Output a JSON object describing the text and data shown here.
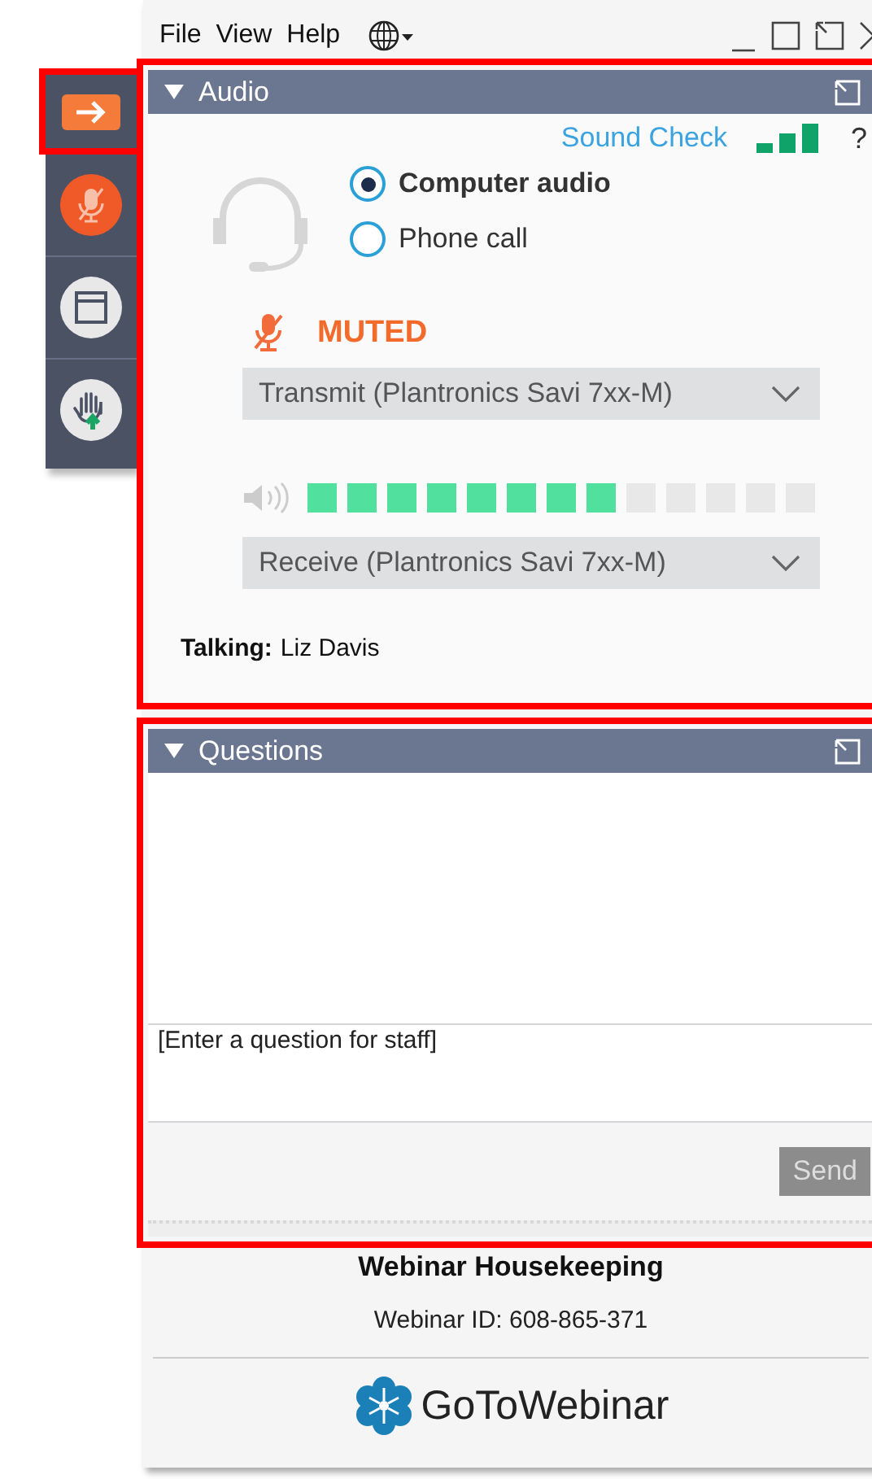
{
  "menu": [
    "File",
    "View",
    "Help"
  ],
  "audio": {
    "title": "Audio",
    "sound_check": "Sound Check",
    "help": "?",
    "options": [
      {
        "label": "Computer audio",
        "selected": true
      },
      {
        "label": "Phone call",
        "selected": false
      }
    ],
    "status": "MUTED",
    "transmit": "Transmit (Plantronics Savi 7xx-M)",
    "meter": {
      "level": 0.61
    },
    "receive": "Receive (Plantronics Savi 7xx-M)",
    "talking_label": "Talking:",
    "talker": "Liz Davis"
  },
  "questions": {
    "title": "Questions",
    "placeholder": "[Enter a question for staff]",
    "send": "Send",
    "send_disabled": true
  },
  "footer": {
    "title": "Webinar Housekeeping",
    "webinar_id": "Webinar ID: 608-865-371",
    "logo": "**GoTo**Webinar"
  }
}
